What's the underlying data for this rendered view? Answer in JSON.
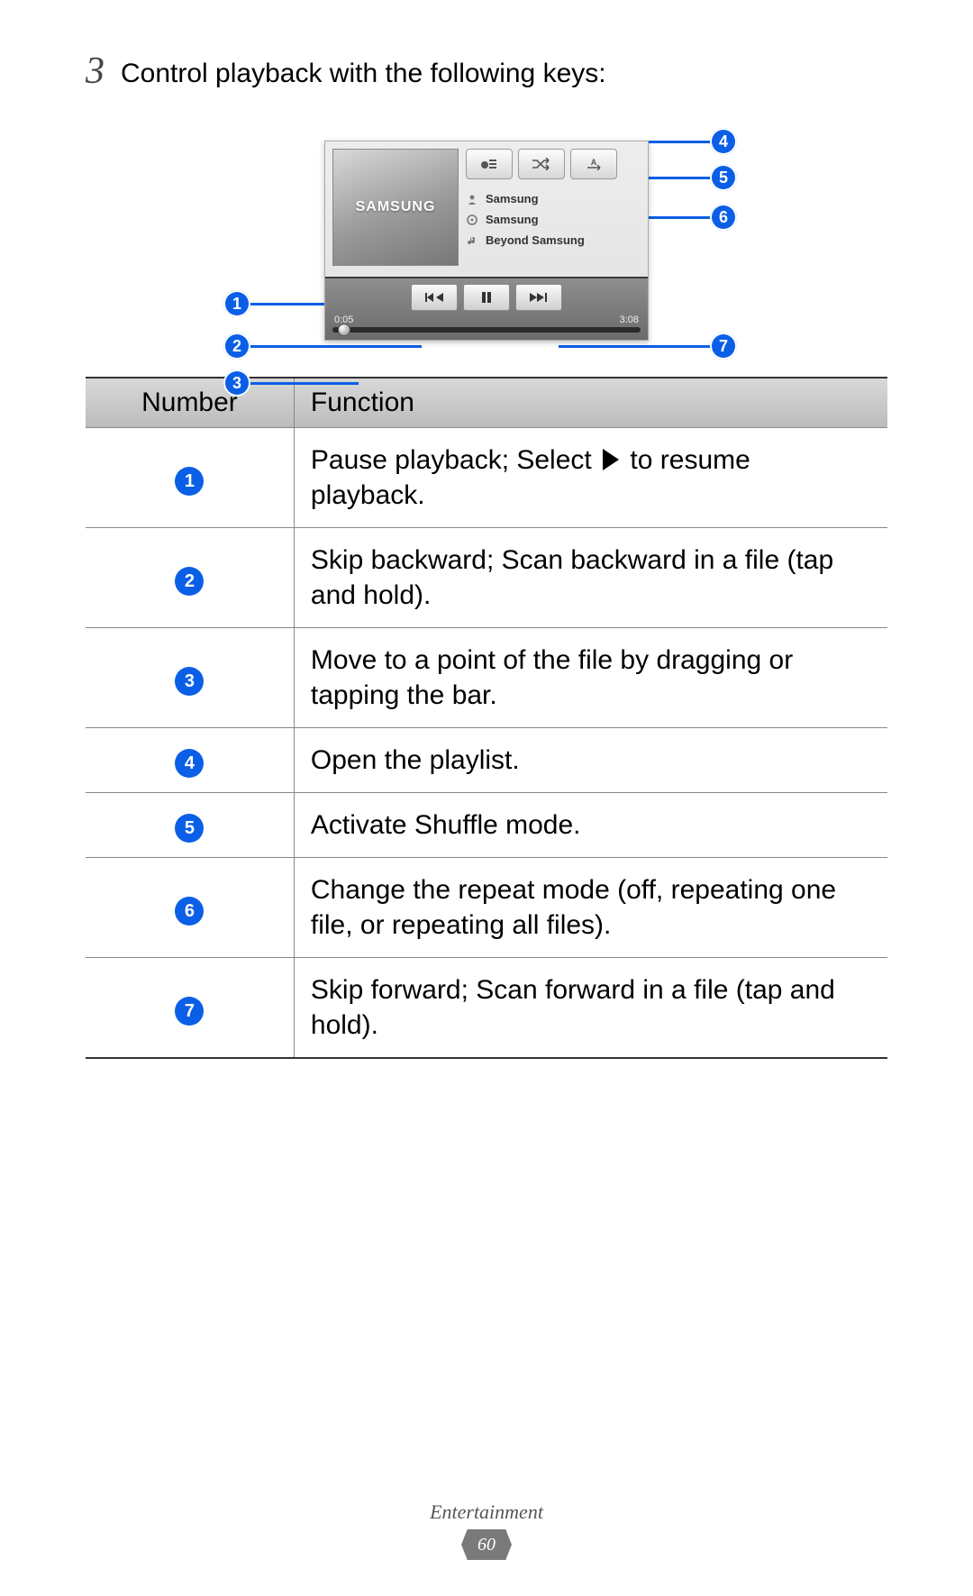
{
  "step": {
    "number": "3",
    "text": "Control playback with the following keys:"
  },
  "player": {
    "brand": "SAMSUNG",
    "artist": "Samsung",
    "album": "Samsung",
    "track": "Beyond Samsung",
    "time_elapsed": "0:05",
    "time_total": "3:08"
  },
  "callouts": [
    "1",
    "2",
    "3",
    "4",
    "5",
    "6",
    "7"
  ],
  "table": {
    "headers": {
      "number": "Number",
      "function": "Function"
    },
    "rows": [
      {
        "n": "1",
        "func_pre": "Pause playback; Select ",
        "func_post": " to resume playback.",
        "has_play_icon": true
      },
      {
        "n": "2",
        "func": "Skip backward; Scan backward in a file (tap and hold)."
      },
      {
        "n": "3",
        "func": "Move to a point of the file by dragging or tapping the bar."
      },
      {
        "n": "4",
        "func": "Open the playlist."
      },
      {
        "n": "5",
        "func": "Activate Shuffle mode."
      },
      {
        "n": "6",
        "func": "Change the repeat mode (off, repeating one file, or repeating all files)."
      },
      {
        "n": "7",
        "func": "Skip forward; Scan forward in a file (tap and hold)."
      }
    ]
  },
  "footer": {
    "section": "Entertainment",
    "page": "60"
  }
}
